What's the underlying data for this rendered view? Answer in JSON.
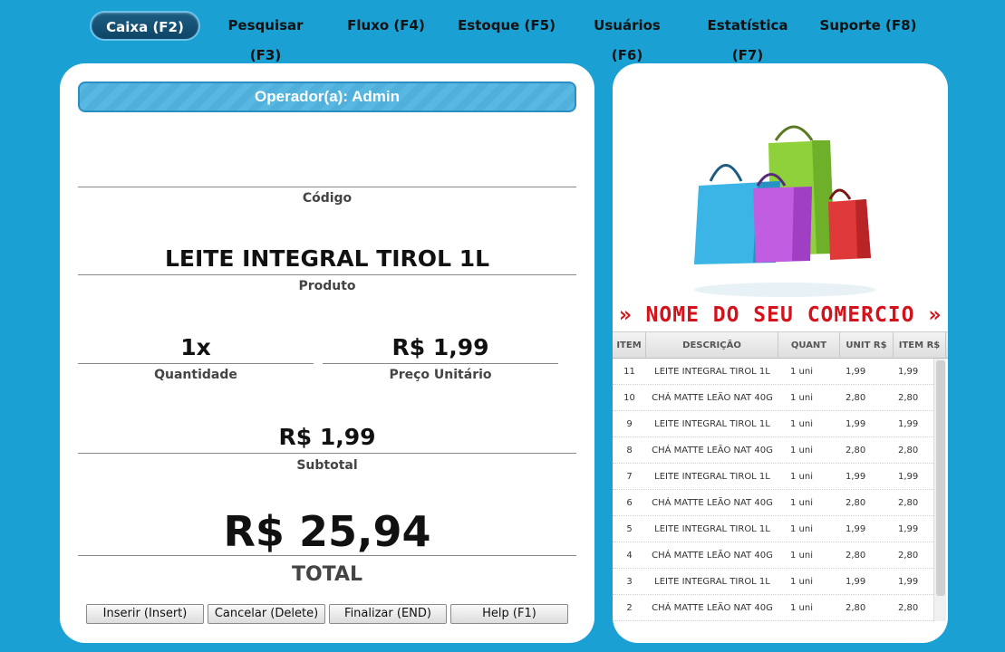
{
  "nav": [
    {
      "label": "Caixa (F2)",
      "active": true
    },
    {
      "label": "Pesquisar (F3)",
      "active": false
    },
    {
      "label": "Fluxo (F4)",
      "active": false
    },
    {
      "label": "Estoque (F5)",
      "active": false
    },
    {
      "label": "Usuários (F6)",
      "active": false
    },
    {
      "label": "Estatística (F7)",
      "active": false
    },
    {
      "label": "Suporte (F8)",
      "active": false
    }
  ],
  "operator": "Operador(a): Admin",
  "codigo": {
    "value": "",
    "label": "Código"
  },
  "produto": {
    "value": "LEITE INTEGRAL TIROL 1L",
    "label": "Produto"
  },
  "quantidade": {
    "value": "1x",
    "label": "Quantidade"
  },
  "preco_unitario": {
    "value": "R$ 1,99",
    "label": "Preço Unitário"
  },
  "subtotal": {
    "value": "R$ 1,99",
    "label": "Subtotal"
  },
  "total": {
    "value": "R$ 25,94",
    "label": "TOTAL"
  },
  "buttons": {
    "inserir": "Inserir (Insert)",
    "cancelar": "Cancelar (Delete)",
    "finalizar": "Finalizar (END)",
    "help": "Help (F1)"
  },
  "store_name": "» NOME DO SEU COMERCIO »",
  "table": {
    "headers": [
      "ITEM",
      "DESCRIÇÃO",
      "QUANT",
      "UNIT R$",
      "ITEM R$"
    ],
    "rows": [
      [
        "11",
        "LEITE INTEGRAL TIROL 1L",
        "1 uni",
        "1,99",
        "1,99"
      ],
      [
        "10",
        "CHÁ MATTE LEÃO NAT 40G",
        "1 uni",
        "2,80",
        "2,80"
      ],
      [
        "9",
        "LEITE INTEGRAL TIROL 1L",
        "1 uni",
        "1,99",
        "1,99"
      ],
      [
        "8",
        "CHÁ MATTE LEÃO NAT 40G",
        "1 uni",
        "2,80",
        "2,80"
      ],
      [
        "7",
        "LEITE INTEGRAL TIROL 1L",
        "1 uni",
        "1,99",
        "1,99"
      ],
      [
        "6",
        "CHÁ MATTE LEÃO NAT 40G",
        "1 uni",
        "2,80",
        "2,80"
      ],
      [
        "5",
        "LEITE INTEGRAL TIROL 1L",
        "1 uni",
        "1,99",
        "1,99"
      ],
      [
        "4",
        "CHÁ MATTE LEÃO NAT 40G",
        "1 uni",
        "2,80",
        "2,80"
      ],
      [
        "3",
        "LEITE INTEGRAL TIROL 1L",
        "1 uni",
        "1,99",
        "1,99"
      ],
      [
        "2",
        "CHÁ MATTE LEÃO NAT 40G",
        "1 uni",
        "2,80",
        "2,80"
      ]
    ]
  },
  "colors": {
    "background": "#1aa0d3",
    "store_name": "#d4121b",
    "nav_active": "#0f4566"
  }
}
